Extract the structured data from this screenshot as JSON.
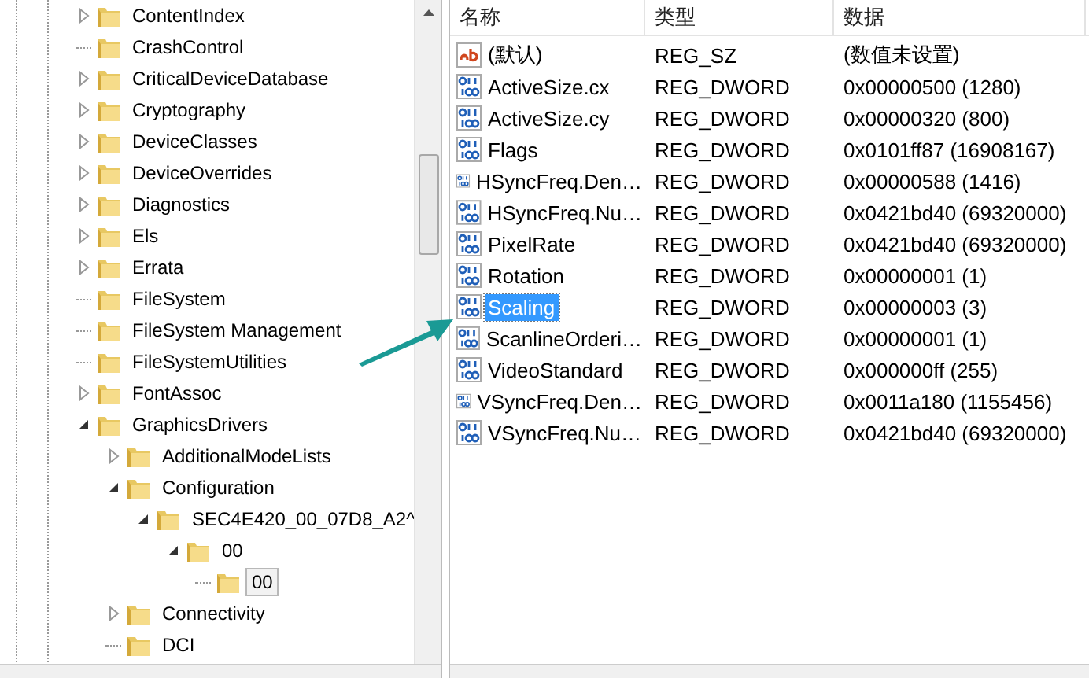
{
  "tree": [
    {
      "label": "ContentIndex",
      "expandable": true,
      "expanded": false,
      "selected": false
    },
    {
      "label": "CrashControl",
      "expandable": false,
      "selected": false
    },
    {
      "label": "CriticalDeviceDatabase",
      "expandable": true,
      "expanded": false,
      "selected": false
    },
    {
      "label": "Cryptography",
      "expandable": true,
      "expanded": false,
      "selected": false
    },
    {
      "label": "DeviceClasses",
      "expandable": true,
      "expanded": false,
      "selected": false
    },
    {
      "label": "DeviceOverrides",
      "expandable": true,
      "expanded": false,
      "selected": false
    },
    {
      "label": "Diagnostics",
      "expandable": true,
      "expanded": false,
      "selected": false
    },
    {
      "label": "Els",
      "expandable": true,
      "expanded": false,
      "selected": false
    },
    {
      "label": "Errata",
      "expandable": true,
      "expanded": false,
      "selected": false
    },
    {
      "label": "FileSystem",
      "expandable": false,
      "selected": false
    },
    {
      "label": "FileSystem Management",
      "expandable": false,
      "selected": false
    },
    {
      "label": "FileSystemUtilities",
      "expandable": false,
      "selected": false
    },
    {
      "label": "FontAssoc",
      "expandable": true,
      "expanded": false,
      "selected": false
    },
    {
      "label": "GraphicsDrivers",
      "expandable": true,
      "expanded": true,
      "selected": false,
      "children": [
        {
          "label": "AdditionalModeLists",
          "expandable": true,
          "expanded": false,
          "selected": false
        },
        {
          "label": "Configuration",
          "expandable": true,
          "expanded": true,
          "selected": false,
          "children": [
            {
              "label": "SEC4E420_00_07D8_A2^",
              "expandable": true,
              "expanded": true,
              "selected": false,
              "children": [
                {
                  "label": "00",
                  "expandable": true,
                  "expanded": true,
                  "selected": false,
                  "children": [
                    {
                      "label": "00",
                      "expandable": false,
                      "selected": true
                    }
                  ]
                }
              ]
            }
          ]
        },
        {
          "label": "Connectivity",
          "expandable": true,
          "expanded": false,
          "selected": false
        },
        {
          "label": "DCI",
          "expandable": false,
          "selected": false
        }
      ]
    }
  ],
  "table": {
    "columns": [
      "名称",
      "类型",
      "数据"
    ],
    "rows": [
      {
        "kind": "string",
        "name": "(默认)",
        "type": "REG_SZ",
        "data": "(数值未设置)",
        "selected": false
      },
      {
        "kind": "dword",
        "name": "ActiveSize.cx",
        "type": "REG_DWORD",
        "data": "0x00000500 (1280)",
        "selected": false
      },
      {
        "kind": "dword",
        "name": "ActiveSize.cy",
        "type": "REG_DWORD",
        "data": "0x00000320 (800)",
        "selected": false
      },
      {
        "kind": "dword",
        "name": "Flags",
        "type": "REG_DWORD",
        "data": "0x0101ff87 (16908167)",
        "selected": false
      },
      {
        "kind": "dword",
        "name": "HSyncFreq.Den…",
        "type": "REG_DWORD",
        "data": "0x00000588 (1416)",
        "selected": false
      },
      {
        "kind": "dword",
        "name": "HSyncFreq.Nu…",
        "type": "REG_DWORD",
        "data": "0x0421bd40 (69320000)",
        "selected": false
      },
      {
        "kind": "dword",
        "name": "PixelRate",
        "type": "REG_DWORD",
        "data": "0x0421bd40 (69320000)",
        "selected": false
      },
      {
        "kind": "dword",
        "name": "Rotation",
        "type": "REG_DWORD",
        "data": "0x00000001 (1)",
        "selected": false
      },
      {
        "kind": "dword",
        "name": "Scaling",
        "type": "REG_DWORD",
        "data": "0x00000003 (3)",
        "selected": true
      },
      {
        "kind": "dword",
        "name": "ScanlineOrderi…",
        "type": "REG_DWORD",
        "data": "0x00000001 (1)",
        "selected": false
      },
      {
        "kind": "dword",
        "name": "VideoStandard",
        "type": "REG_DWORD",
        "data": "0x000000ff (255)",
        "selected": false
      },
      {
        "kind": "dword",
        "name": "VSyncFreq.Den…",
        "type": "REG_DWORD",
        "data": "0x0011a180 (1155456)",
        "selected": false
      },
      {
        "kind": "dword",
        "name": "VSyncFreq.Nu…",
        "type": "REG_DWORD",
        "data": "0x0421bd40 (69320000)",
        "selected": false
      }
    ]
  }
}
